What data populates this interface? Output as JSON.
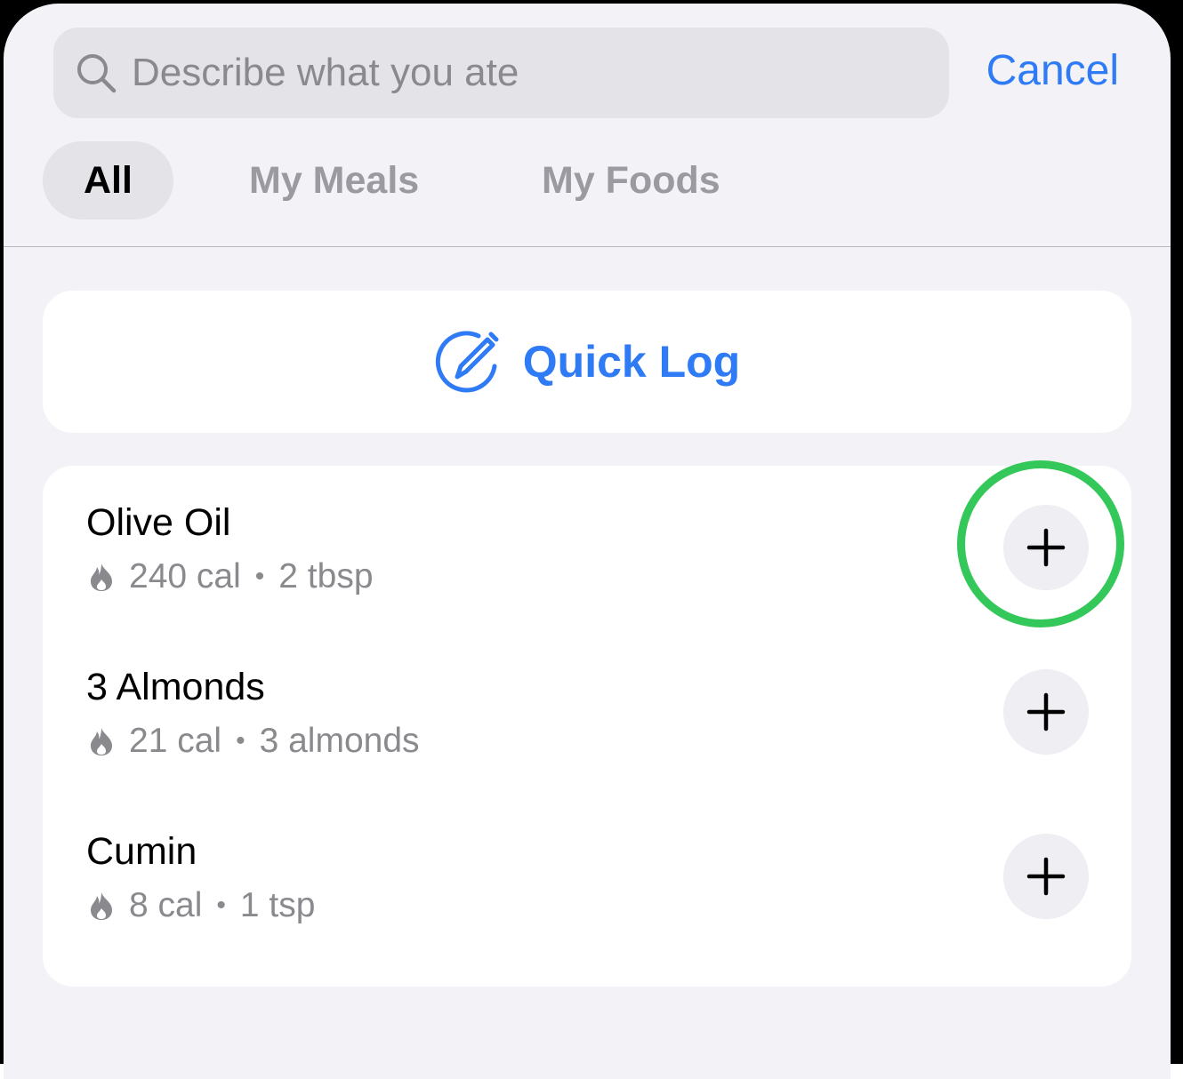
{
  "search": {
    "placeholder": "Describe what you ate",
    "cancel_label": "Cancel"
  },
  "segments": [
    {
      "label": "All",
      "active": true
    },
    {
      "label": "My Meals",
      "active": false
    },
    {
      "label": "My Foods",
      "active": false
    }
  ],
  "quick_log": {
    "label": "Quick Log",
    "icon": "pencil-circle-icon"
  },
  "foods": [
    {
      "name": "Olive Oil",
      "calories": "240 cal",
      "serving": "2 tbsp",
      "separator": "•"
    },
    {
      "name": "3 Almonds",
      "calories": "21 cal",
      "serving": "3 almonds",
      "separator": "•"
    },
    {
      "name": "Cumin",
      "calories": "8 cal",
      "serving": "1 tsp",
      "separator": "•"
    }
  ],
  "icons": {
    "search": "search-icon",
    "flame": "flame-icon",
    "add": "plus-icon"
  },
  "colors": {
    "accent": "#2f7af5",
    "highlight": "#34c759",
    "background": "#f2f2f7",
    "secondary_text": "#8a8a8e"
  }
}
